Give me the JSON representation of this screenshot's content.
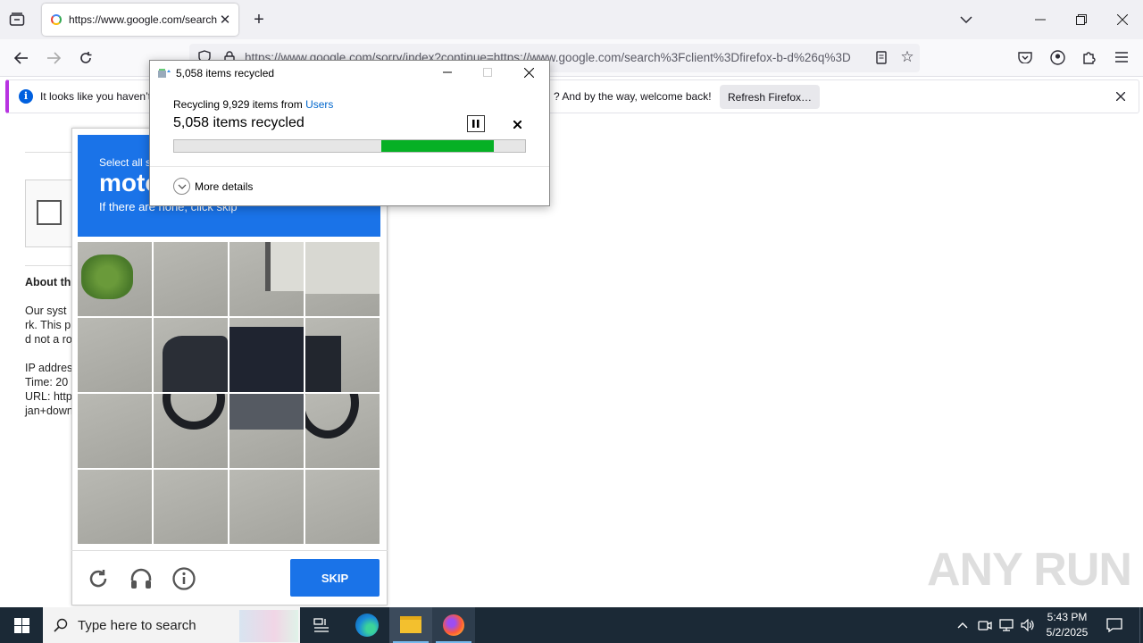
{
  "browser": {
    "tab_title": "https://www.google.com/search",
    "url": "https://www.google.com/sorry/index?continue=https://www.google.com/search%3Fclient%3Dfirefox-b-d%26q%3D",
    "notification": {
      "text_left": "It looks like you haven’t",
      "text_right": "? And by the way, welcome back!",
      "button": "Refresh Firefox…"
    }
  },
  "page": {
    "about_heading": "About th",
    "body_lines": [
      "Our syst",
      "rk. This p",
      "d not a ro"
    ],
    "meta_lines": [
      "IP addres",
      "Time: 20",
      "URL: http",
      "jan+down"
    ]
  },
  "captcha": {
    "instruction_small": "Select all s",
    "instruction_big": "moto",
    "instruction_hint": "If there are none, click skip",
    "skip_label": "SKIP"
  },
  "recycle_dialog": {
    "title": "5,058 items recycled",
    "source_prefix": "Recycling 9,929 items from ",
    "source_link": "Users",
    "status": "5,058 items recycled",
    "more_details": "More details",
    "progress": {
      "start": 0.59,
      "end": 0.91
    }
  },
  "taskbar": {
    "search_placeholder": "Type here to search",
    "time": "5:43 PM",
    "date": "5/2/2025"
  },
  "watermark": "ANY RUN",
  "colors": {
    "accent": "#1a73e8",
    "progress": "#06b025",
    "notif_border": "#b833e1",
    "taskbar": "#1b2936"
  }
}
